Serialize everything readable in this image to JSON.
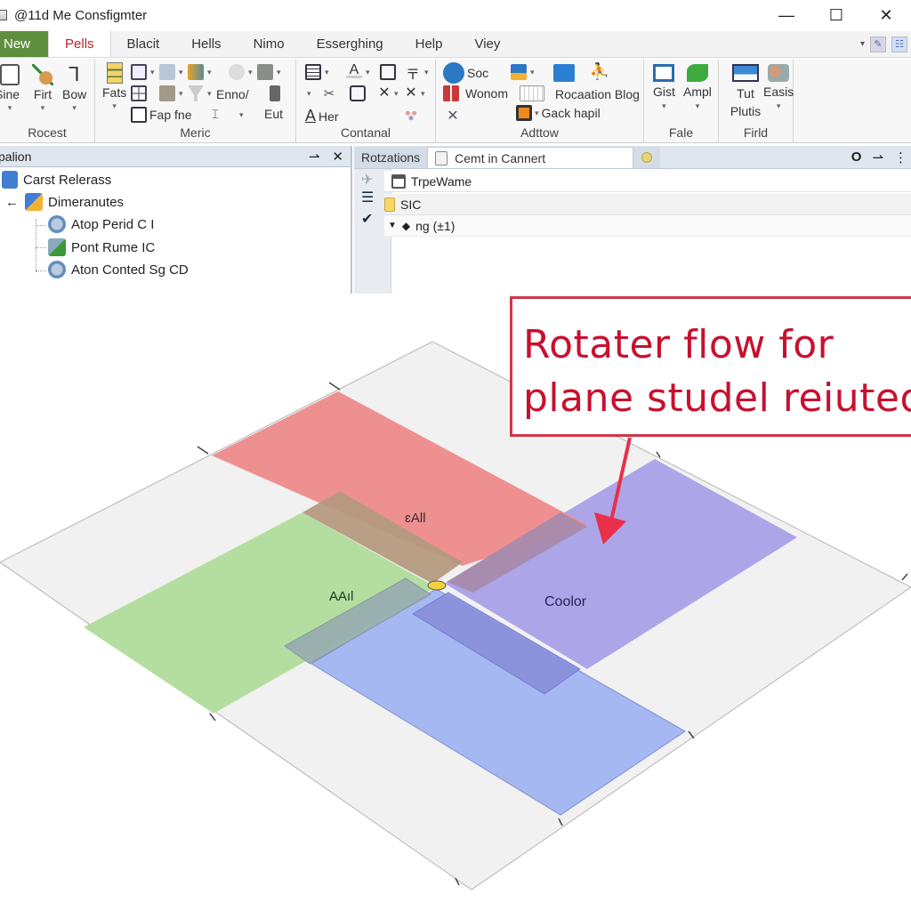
{
  "window": {
    "title": "@11d Me Consfigmter",
    "controls": {
      "minimize": "—",
      "maximize": "☐",
      "close": "✕"
    }
  },
  "menubar": {
    "tabs": [
      {
        "label": "New",
        "kind": "file"
      },
      {
        "label": "Pells",
        "kind": "active"
      },
      {
        "label": "Blacit"
      },
      {
        "label": "Hells"
      },
      {
        "label": "Nimo"
      },
      {
        "label": "Esserghing"
      },
      {
        "label": "Help"
      },
      {
        "label": "Viey"
      }
    ],
    "collapse_caret": "▾"
  },
  "ribbon": {
    "groups": [
      {
        "label": "Rocest",
        "buttons": [
          "Sine",
          "Firt",
          "Bow"
        ]
      },
      {
        "label": "Meric",
        "buttons": [
          "Fats",
          "Fap fne",
          "Enno/",
          "Eut"
        ]
      },
      {
        "label": "Contanal",
        "buttons": [
          "Her"
        ]
      },
      {
        "label": "Adttow",
        "buttons": [
          "Soc",
          "Wonom",
          "Rocaation Blog",
          "Gack hapil"
        ]
      },
      {
        "label": "Fale",
        "buttons": [
          "Gist",
          "Ampl"
        ]
      },
      {
        "label": "Firld",
        "buttons": [
          "Tut Plutis",
          "Easis"
        ]
      }
    ]
  },
  "left_panel": {
    "title": "palion",
    "pin": "⇀",
    "close": "✕",
    "tree": [
      {
        "label": "Carst Relerass",
        "level": 0
      },
      {
        "label": "Dimeranutes",
        "level": 0,
        "expander": "←"
      },
      {
        "label": "Atop Perid C I",
        "level": 1
      },
      {
        "label": "Pont Rume IC",
        "level": 1
      },
      {
        "label": "Aton Conted Sg CD",
        "level": 1
      }
    ]
  },
  "right_panel": {
    "tabs": [
      {
        "label": "Rotzations"
      },
      {
        "label": "Cemt in Cannert"
      },
      {
        "label": ""
      }
    ],
    "controls": {
      "circle": "O",
      "arrow": "⇀",
      "more": "⋮"
    },
    "rows": {
      "name_header": "TrpeWame",
      "sic": "SIC",
      "ng": "ng (±1)"
    }
  },
  "diagram": {
    "callout_lines": [
      "Rotater flow for",
      "plane studel reiuted"
    ],
    "labels": {
      "red_plane": "ɛAll",
      "green_plane": "AAıl",
      "purple_plane": "Coolor"
    },
    "colors": {
      "red": "#ee8a8a",
      "green": "#b4dea0",
      "purple": "#a8a0e6",
      "blue": "#a6b8f2",
      "grid": "#f1f1f1",
      "callout": "#c8102e"
    }
  }
}
